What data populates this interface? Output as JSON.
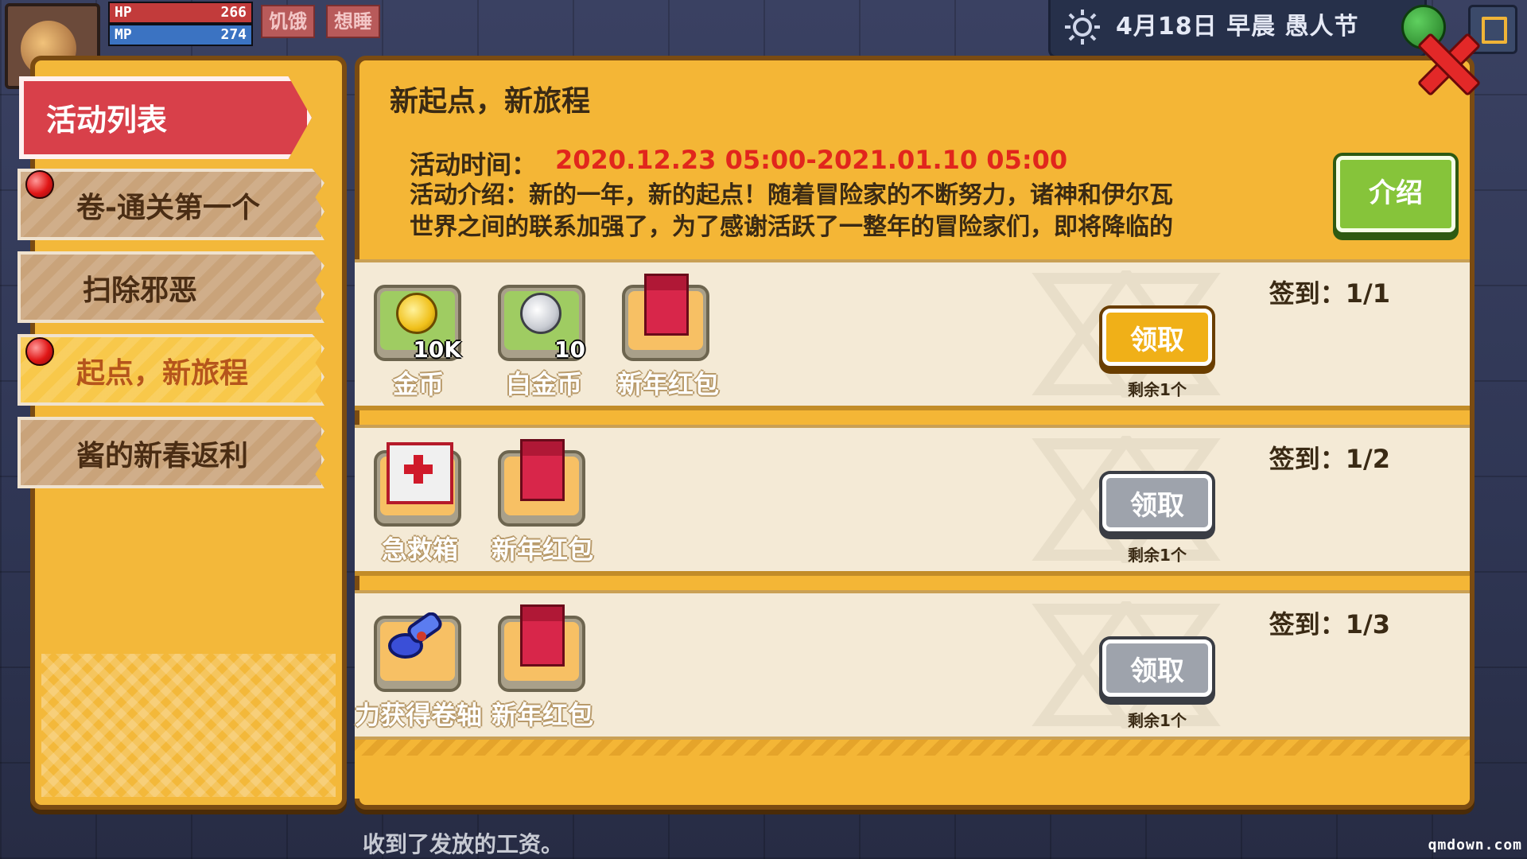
{
  "hud": {
    "hp_label": "HP",
    "hp_value": "266",
    "hp_fraction": 1.0,
    "mp_label": "MP",
    "mp_value": "274",
    "mp_fraction": 1.0,
    "status_hungry": "饥饿",
    "status_sleepy": "想睡"
  },
  "top_info": {
    "date_text": "4月18日  早晨  愚人节"
  },
  "left_panel": {
    "header": "活动列表",
    "items": [
      {
        "label": "卷-通关第一个",
        "has_red_dot": true,
        "active": false
      },
      {
        "label": "扫除邪恶",
        "has_red_dot": false,
        "active": false
      },
      {
        "label": "起点，新旅程",
        "has_red_dot": true,
        "active": true
      },
      {
        "label": "酱的新春返利",
        "has_red_dot": false,
        "active": false
      }
    ]
  },
  "event": {
    "title": "新起点，新旅程",
    "time_label": "活动时间：",
    "time_value": "2020.12.23 05:00-2021.01.10 05:00",
    "desc_line1": "活动介绍：新的一年，新的起点！随着冒险家的不断努力，诸神和伊尔瓦",
    "desc_line2": "世界之间的联系加强了，为了感谢活跃了一整年的冒险家们，即将降临的",
    "intro_button": "介绍"
  },
  "rewards": [
    {
      "sign_in": "签到：1/1",
      "button": "领取",
      "button_state": "enabled",
      "remaining": "剩余1个",
      "items": [
        {
          "name": "金币",
          "icon": "gold-coin-icon",
          "qty": "10K"
        },
        {
          "name": "白金币",
          "icon": "platinum-coin-icon",
          "qty": "10"
        },
        {
          "name": "新年红包",
          "icon": "red-envelope-icon",
          "qty": ""
        }
      ]
    },
    {
      "sign_in": "签到：1/2",
      "button": "领取",
      "button_state": "disabled",
      "remaining": "剩余1个",
      "items": [
        {
          "name": "急救箱",
          "icon": "first-aid-kit-icon",
          "qty": ""
        },
        {
          "name": "新年红包",
          "icon": "red-envelope-icon",
          "qty": ""
        }
      ]
    },
    {
      "sign_in": "签到：1/3",
      "button": "领取",
      "button_state": "disabled",
      "remaining": "剩余1个",
      "items": [
        {
          "name": "力获得卷轴",
          "icon": "scroll-icon",
          "qty": ""
        },
        {
          "name": "新年红包",
          "icon": "red-envelope-icon",
          "qty": ""
        }
      ]
    }
  ],
  "bottom_message": "收到了发放的工资。",
  "site_mark": "qmdown.com",
  "colors": {
    "panel": "#f4b636",
    "accent_red": "#e1261c",
    "button_gold": "#f0b018",
    "button_gray": "#9ea3ac",
    "intro_green": "#86c43a"
  }
}
